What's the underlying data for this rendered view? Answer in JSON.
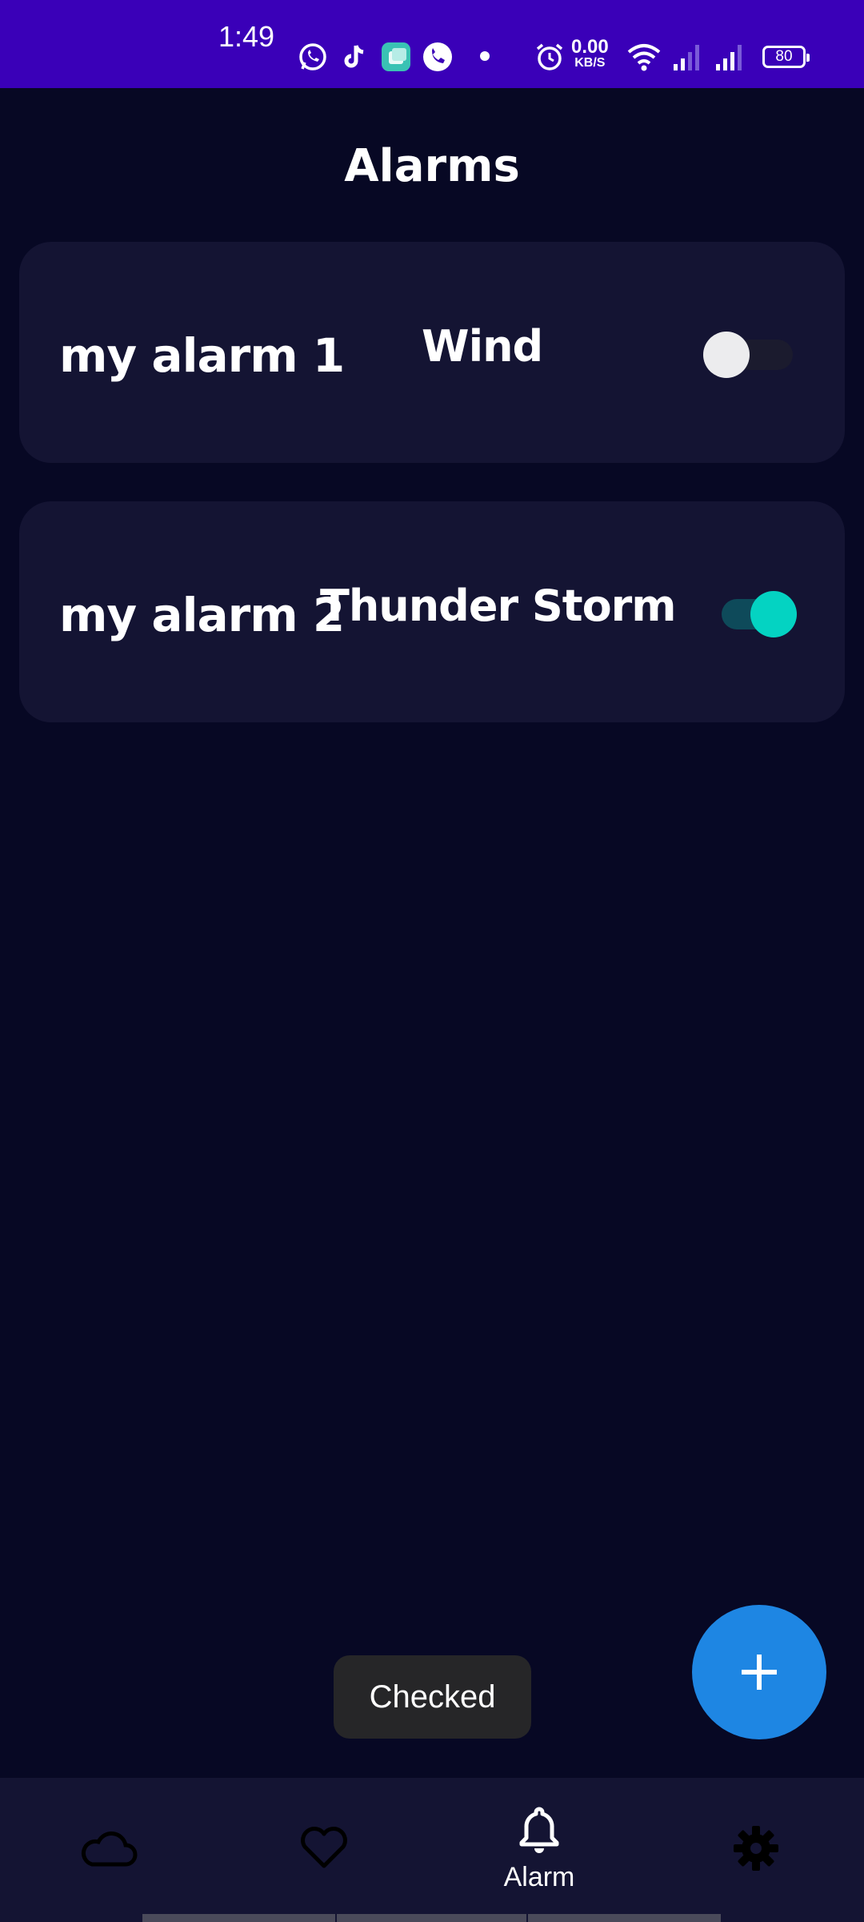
{
  "status_bar": {
    "time": "1:49",
    "net_speed_value": "0.00",
    "net_speed_unit": "KB/S",
    "battery": "80",
    "icons": [
      "whatsapp-icon",
      "tiktok-icon",
      "app-icon",
      "phone-call-icon",
      "dot-icon",
      "alarm-clock-icon",
      "wifi-icon",
      "signal-icon",
      "signal-icon",
      "battery-icon"
    ]
  },
  "header": {
    "title": "Alarms"
  },
  "alarms": [
    {
      "name": "my alarm 1",
      "sound": "Wind",
      "enabled": false
    },
    {
      "name": "my alarm 2",
      "sound": "Thunder Storm",
      "enabled": true
    }
  ],
  "toast": {
    "message": "Checked"
  },
  "fab": {
    "icon": "plus-icon"
  },
  "bottom_nav": {
    "items": [
      {
        "icon": "cloud-icon",
        "label": ""
      },
      {
        "icon": "heart-icon",
        "label": ""
      },
      {
        "icon": "bell-icon",
        "label": "Alarm",
        "active": true
      },
      {
        "icon": "gear-icon",
        "label": ""
      }
    ]
  },
  "colors": {
    "status_bar": "#3a00b8",
    "background": "#070824",
    "card": "#141433",
    "accent_toggle": "#04d3c2",
    "fab": "#1e86e3"
  }
}
